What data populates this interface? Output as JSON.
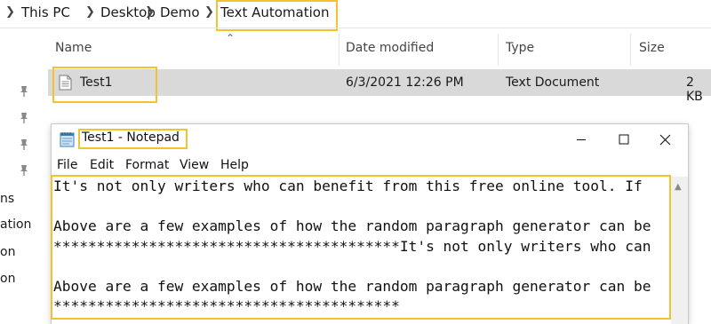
{
  "explorer": {
    "breadcrumb": [
      "This PC",
      "Desktop",
      "Demo",
      "Text Automation"
    ],
    "left_labels": [
      "ns",
      "ation",
      "on",
      "on"
    ],
    "columns": {
      "name": "Name",
      "date": "Date modified",
      "type": "Type",
      "size": "Size"
    },
    "file": {
      "name": "Test1",
      "date": "6/3/2021 12:26 PM",
      "type": "Text Document",
      "size": "2 KB"
    }
  },
  "notepad": {
    "title": "Test1 - Notepad",
    "menu": [
      "File",
      "Edit",
      "Format",
      "View",
      "Help"
    ],
    "lines": [
      "It's not only writers who can benefit from this free online tool. If",
      "",
      "Above are a few examples of how the random paragraph generator can be",
      "****************************************It's not only writers who can",
      "",
      "Above are a few examples of how the random paragraph generator can be",
      "****************************************"
    ]
  },
  "colors": {
    "highlight": "#f2c230",
    "selected_row": "#d9d9d9"
  }
}
